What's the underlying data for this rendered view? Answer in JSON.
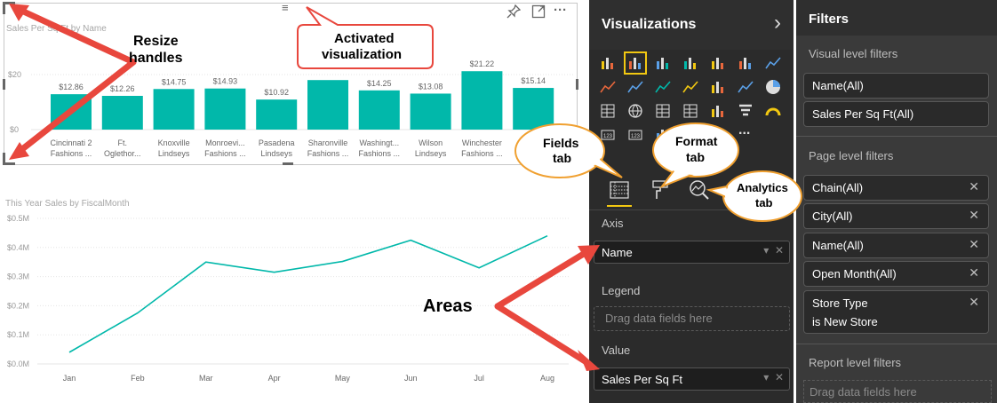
{
  "bar_chart": {
    "title": "Sales Per Sq Ft by Name",
    "y_ticks": [
      "$20",
      "$0"
    ],
    "bars": [
      {
        "label1": "Cincinnati 2",
        "label2": "Fashions ...",
        "value": 12.86,
        "value_label": "$12.86"
      },
      {
        "label1": "Ft.",
        "label2": "Oglethor...",
        "value": 12.26,
        "value_label": "$12.26"
      },
      {
        "label1": "Knoxville",
        "label2": "Lindseys",
        "value": 14.75,
        "value_label": "$14.75"
      },
      {
        "label1": "Monroevi...",
        "label2": "Fashions ...",
        "value": 14.93,
        "value_label": "$14.93"
      },
      {
        "label1": "Pasadena",
        "label2": "Lindseys",
        "value": 10.92,
        "value_label": "$10.92"
      },
      {
        "label1": "Sharonville",
        "label2": "Fashions ...",
        "value": 18.0,
        "value_label": ""
      },
      {
        "label1": "Washingt...",
        "label2": "Fashions ...",
        "value": 14.25,
        "value_label": "$14.25"
      },
      {
        "label1": "Wilson",
        "label2": "Lindseys",
        "value": 13.08,
        "value_label": "$13.08"
      },
      {
        "label1": "Winchester",
        "label2": "Fashions ...",
        "value": 21.22,
        "value_label": "$21.22"
      },
      {
        "label1": "Fa",
        "label2": "",
        "value": 15.14,
        "value_label": "$15.14"
      }
    ],
    "color": "#01b8aa"
  },
  "line_chart": {
    "title": "This Year Sales by FiscalMonth",
    "y_ticks": [
      "$0.5M",
      "$0.4M",
      "$0.3M",
      "$0.2M",
      "$0.1M",
      "$0.0M"
    ],
    "months": [
      "Jan",
      "Feb",
      "Mar",
      "Apr",
      "May",
      "Jun",
      "Jul",
      "Aug"
    ],
    "values": [
      0.04,
      0.175,
      0.35,
      0.315,
      0.352,
      0.425,
      0.33,
      0.44
    ],
    "color": "#01b8aa"
  },
  "chart_data": [
    {
      "type": "bar",
      "title": "Sales Per Sq Ft by Name",
      "categories": [
        "Cincinnati 2 Fashions ...",
        "Ft. Oglethor...",
        "Knoxville Lindseys",
        "Monroevi... Fashions ...",
        "Pasadena Lindseys",
        "Sharonville Fashions ...",
        "Washingt... Fashions ...",
        "Wilson Lindseys",
        "Winchester Fashions ...",
        "Fa"
      ],
      "values": [
        12.86,
        12.26,
        14.75,
        14.93,
        10.92,
        18.0,
        14.25,
        13.08,
        21.22,
        15.14
      ],
      "ylim": [
        0,
        25
      ],
      "grid": true
    },
    {
      "type": "line",
      "title": "This Year Sales by FiscalMonth",
      "x": [
        "Jan",
        "Feb",
        "Mar",
        "Apr",
        "May",
        "Jun",
        "Jul",
        "Aug"
      ],
      "values": [
        0.04,
        0.175,
        0.35,
        0.315,
        0.352,
        0.425,
        0.33,
        0.44
      ],
      "ylim": [
        0,
        0.5
      ],
      "grid": true
    }
  ],
  "visual_toolbar": {
    "focus_icon_name": "focus-mode-icon",
    "pin_icon_name": "pin-icon",
    "more_label": "···"
  },
  "visualizations_pane": {
    "title": "Visualizations",
    "chevron": "›",
    "more_label": "...",
    "tabs": {
      "fields": "fields-tab",
      "format": "format-tab",
      "analytics": "analytics-tab"
    },
    "wells": {
      "axis_label": "Axis",
      "axis_value": "Name",
      "legend_label": "Legend",
      "legend_placeholder": "Drag data fields here",
      "value_label": "Value",
      "value_value": "Sales Per Sq Ft"
    }
  },
  "filters_pane": {
    "title": "Filters",
    "visual_level_label": "Visual level filters",
    "visual_filters": [
      "Name(All)",
      "Sales Per Sq Ft(All)"
    ],
    "page_level_label": "Page level filters",
    "page_filters": [
      "Chain(All)",
      "City(All)",
      "Name(All)",
      "Open Month(All)"
    ],
    "page_filter_multiline": {
      "line1": "Store Type",
      "line2": "is New Store"
    },
    "report_level_label": "Report level filters",
    "report_placeholder": "Drag data fields here",
    "close_glyph": "✕"
  },
  "annotations": {
    "resize_line1": "Resize",
    "resize_line2": "handles",
    "activated_line1": "Activated",
    "activated_line2": "visualization",
    "fields_line1": "Fields",
    "fields_line2": "tab",
    "format_line1": "Format",
    "format_line2": "tab",
    "analytics_line1": "Analytics",
    "analytics_line2": "tab",
    "areas": "Areas"
  }
}
